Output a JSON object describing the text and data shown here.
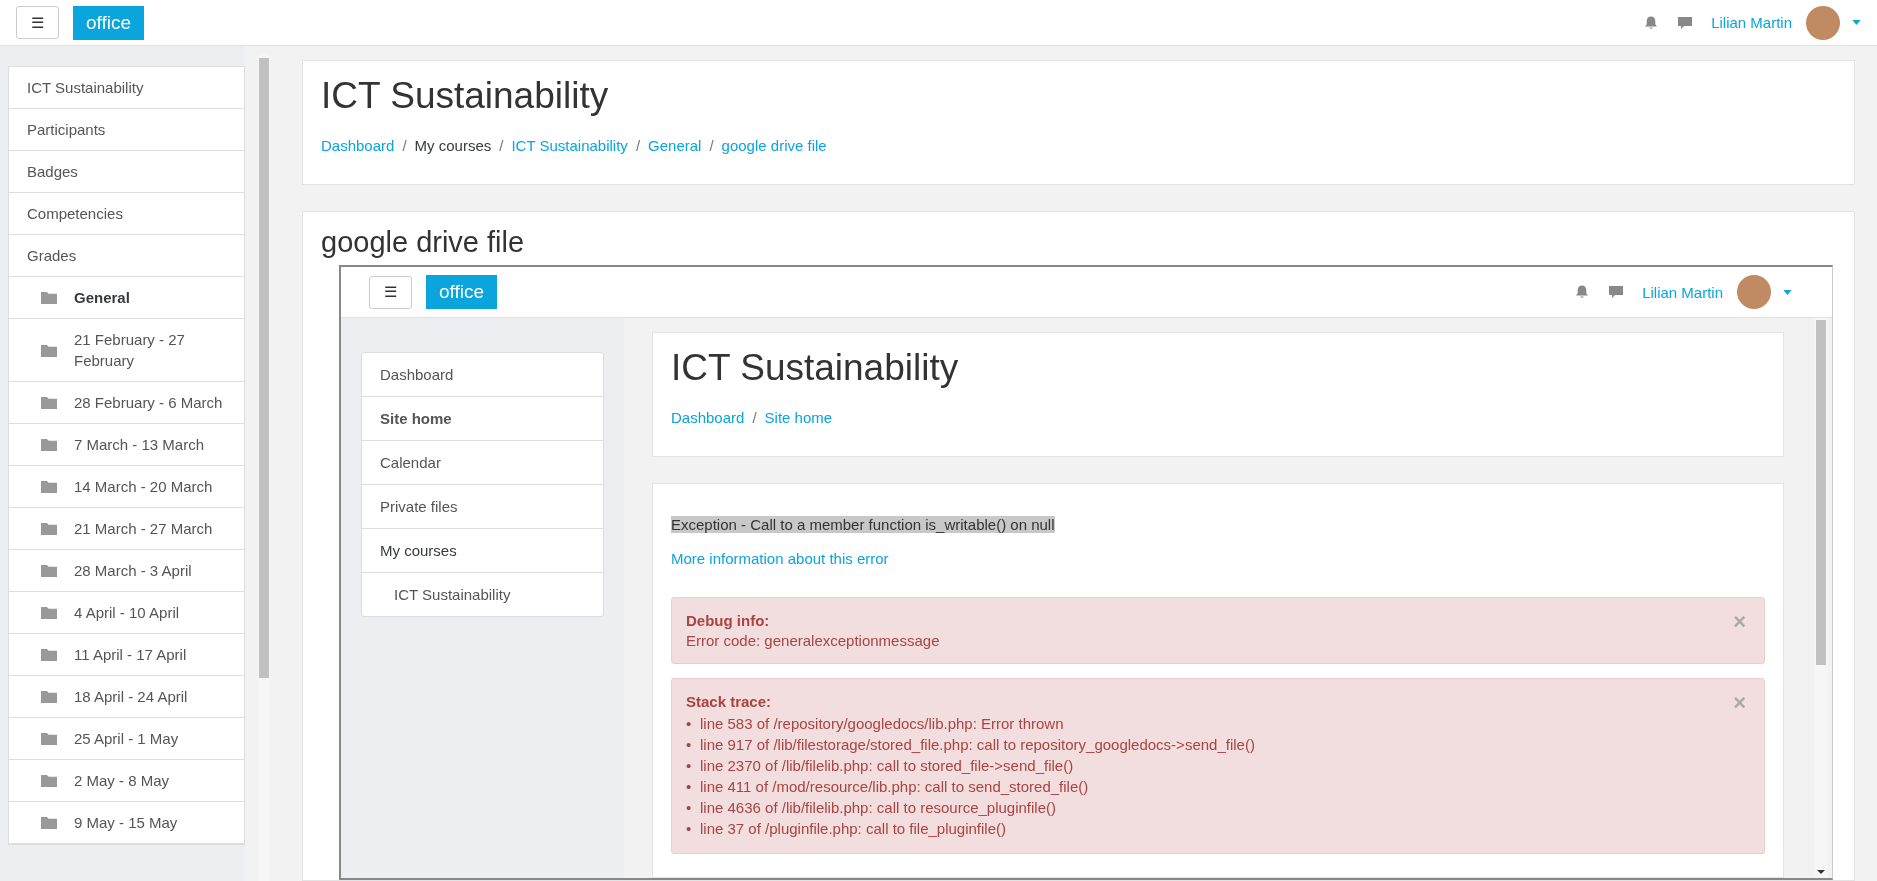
{
  "navbar": {
    "menu_button": "☰",
    "brand": "office",
    "user_name": "Lilian Martin"
  },
  "sidebar": {
    "items": [
      {
        "label": "ICT Sustainability",
        "kind": "link",
        "selected": false
      },
      {
        "label": "Participants",
        "kind": "link",
        "selected": false
      },
      {
        "label": "Badges",
        "kind": "link",
        "selected": false
      },
      {
        "label": "Competencies",
        "kind": "link",
        "selected": false
      },
      {
        "label": "Grades",
        "kind": "link",
        "selected": false
      },
      {
        "label": "General",
        "kind": "section",
        "selected": true
      },
      {
        "label": "21 February - 27 February",
        "kind": "section",
        "selected": false
      },
      {
        "label": "28 February - 6 March",
        "kind": "section",
        "selected": false
      },
      {
        "label": "7 March - 13 March",
        "kind": "section",
        "selected": false
      },
      {
        "label": "14 March - 20 March",
        "kind": "section",
        "selected": false
      },
      {
        "label": "21 March - 27 March",
        "kind": "section",
        "selected": false
      },
      {
        "label": "28 March - 3 April",
        "kind": "section",
        "selected": false
      },
      {
        "label": "4 April - 10 April",
        "kind": "section",
        "selected": false
      },
      {
        "label": "11 April - 17 April",
        "kind": "section",
        "selected": false
      },
      {
        "label": "18 April - 24 April",
        "kind": "section",
        "selected": false
      },
      {
        "label": "25 April - 1 May",
        "kind": "section",
        "selected": false
      },
      {
        "label": "2 May - 8 May",
        "kind": "section",
        "selected": false
      },
      {
        "label": "9 May - 15 May",
        "kind": "section",
        "selected": false
      }
    ]
  },
  "page_header": {
    "title": "ICT Sustainability",
    "separator": "/",
    "breadcrumb": [
      {
        "label": "Dashboard",
        "link": true
      },
      {
        "label": "My courses",
        "link": false
      },
      {
        "label": "ICT Sustainability",
        "link": true
      },
      {
        "label": "General",
        "link": true
      },
      {
        "label": "google drive file",
        "link": true
      }
    ]
  },
  "activity": {
    "title": "google drive file",
    "embedded_page": {
      "navbar": {
        "menu_button": "☰",
        "brand": "office",
        "user_name": "Lilian Martin"
      },
      "sidebar": {
        "items": [
          {
            "label": "Dashboard",
            "kind": "link",
            "selected": false
          },
          {
            "label": "Site home",
            "kind": "link",
            "selected": true
          },
          {
            "label": "Calendar",
            "kind": "link",
            "selected": false
          },
          {
            "label": "Private files",
            "kind": "link",
            "selected": false
          },
          {
            "label": "My courses",
            "kind": "heading",
            "selected": false
          },
          {
            "label": "ICT Sustainability",
            "kind": "child",
            "selected": false
          }
        ]
      },
      "page_header": {
        "title": "ICT Sustainability",
        "separator": "/",
        "breadcrumb": [
          {
            "label": "Dashboard",
            "link": true
          },
          {
            "label": "Site home",
            "link": true
          }
        ]
      },
      "error": {
        "message": "Exception - Call to a member function is_writable() on null",
        "more_info_link": "More information about this error",
        "alerts": [
          {
            "kind": "text",
            "title": "Debug info:",
            "close": "×",
            "text": "Error code: generalexceptionmessage"
          },
          {
            "kind": "list",
            "title": "Stack trace:",
            "close": "×",
            "bullet": "•",
            "items": [
              "line 583 of /repository/googledocs/lib.php: Error thrown",
              "line 917 of /lib/filestorage/stored_file.php: call to repository_googledocs->send_file()",
              "line 2370 of /lib/filelib.php: call to stored_file->send_file()",
              "line 411 of /mod/resource/lib.php: call to send_stored_file()",
              "line 4636 of /lib/filelib.php: call to resource_pluginfile()",
              "line 37 of /pluginfile.php: call to file_pluginfile()"
            ]
          }
        ]
      }
    }
  }
}
